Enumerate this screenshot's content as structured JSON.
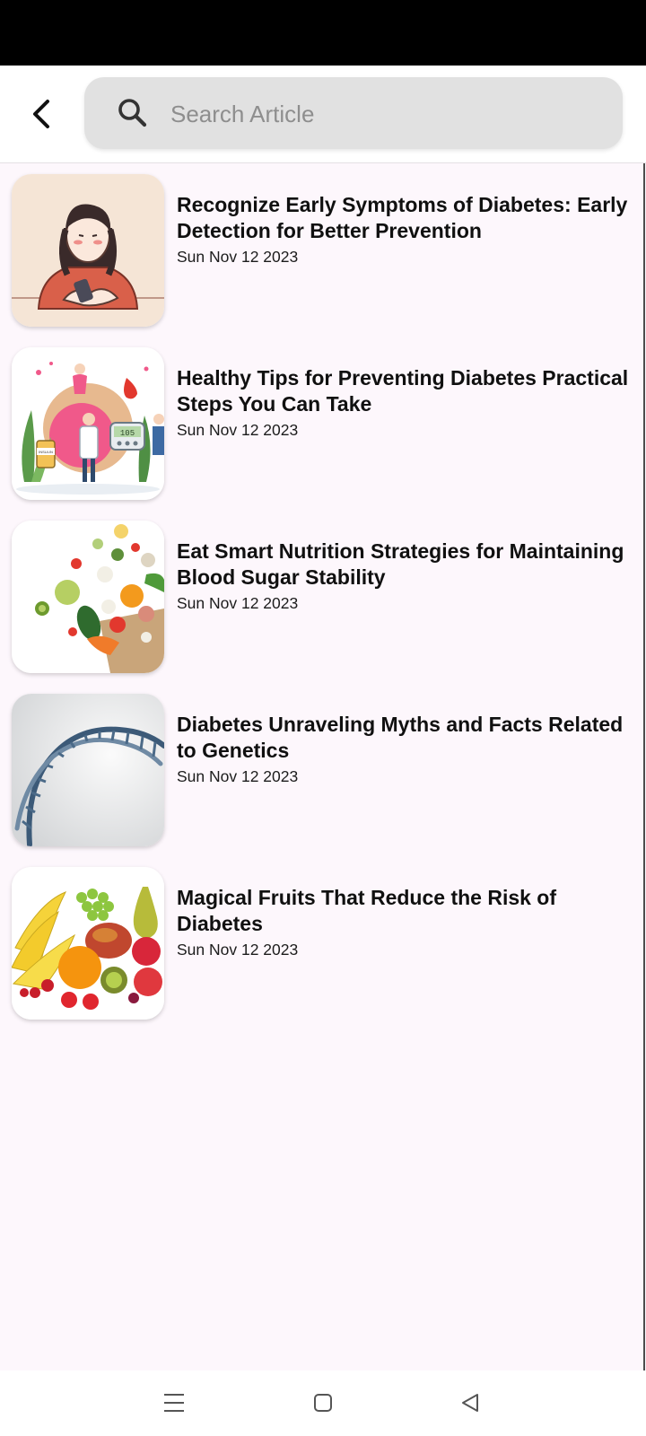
{
  "search": {
    "placeholder": "Search Article",
    "value": ""
  },
  "icons": {
    "back": "back-arrow-icon",
    "search": "search-icon",
    "nav_menu": "menu-icon",
    "nav_home": "home-square-icon",
    "nav_back": "back-triangle-icon"
  },
  "colors": {
    "background": "#fdf7fc",
    "search_bg": "#e1e1e1",
    "title_text": "#101010"
  },
  "articles": [
    {
      "title": "Recognize Early Symptoms of Diabetes: Early Detection for Better Prevention",
      "date": "Sun Nov 12 2023",
      "image": "woman-checking-blood-glucose-illustration"
    },
    {
      "title": "Healthy Tips for Preventing Diabetes Practical Steps You Can Take",
      "date": "Sun Nov 12 2023",
      "image": "doctors-glucometer-insulin-illustration",
      "image_text": {
        "meter_reading": "105",
        "bottle_label": "INSULIN"
      }
    },
    {
      "title": "Eat Smart Nutrition Strategies for Maintaining Blood Sugar Stability",
      "date": "Sun Nov 12 2023",
      "image": "vegetables-and-fruits-paper-bag-photo"
    },
    {
      "title": "Diabetes  Unraveling Myths and Facts Related to Genetics",
      "date": "Sun Nov 12 2023",
      "image": "dna-double-helix-image"
    },
    {
      "title": "Magical Fruits That Reduce the Risk of Diabetes",
      "date": "Sun Nov 12 2023",
      "image": "assorted-fresh-fruits-photo"
    }
  ]
}
